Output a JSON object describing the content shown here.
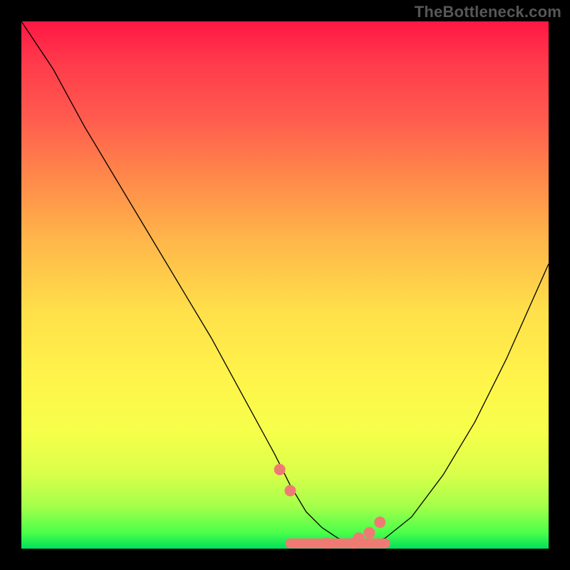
{
  "watermark": "TheBottleneck.com",
  "colors": {
    "background_frame": "#000000",
    "gradient_top": "#ff1744",
    "gradient_mid": "#ffe04a",
    "gradient_bottom": "#00e05a",
    "curve_stroke": "#000000",
    "accent_stroke": "#ef7a74"
  },
  "chart_data": {
    "type": "line",
    "title": "",
    "xlabel": "",
    "ylabel": "",
    "xlim": [
      0,
      100
    ],
    "ylim": [
      0,
      100
    ],
    "grid": false,
    "legend": false,
    "series": [
      {
        "name": "bottleneck-curve",
        "x": [
          0,
          6,
          12,
          18,
          24,
          30,
          36,
          42,
          48,
          51,
          54,
          57,
          60,
          63,
          66,
          69,
          74,
          80,
          86,
          92,
          100
        ],
        "values": [
          100,
          91,
          80,
          70,
          60,
          50,
          40,
          29,
          18,
          12,
          7,
          4,
          2,
          1,
          1,
          2,
          6,
          14,
          24,
          36,
          54
        ]
      }
    ],
    "annotations": {
      "accent_flat_region_x": [
        51,
        69
      ],
      "accent_flat_region_y": 1,
      "accent_dots_x": [
        49,
        51,
        58,
        63,
        64,
        66,
        68
      ],
      "accent_dots_y": [
        15,
        11,
        1,
        1,
        2,
        3,
        5
      ]
    },
    "background_gradient": {
      "type": "vertical",
      "stops": [
        {
          "pos": 0.0,
          "color": "#ff1744"
        },
        {
          "pos": 0.3,
          "color": "#ff8a4a"
        },
        {
          "pos": 0.55,
          "color": "#ffe04a"
        },
        {
          "pos": 0.78,
          "color": "#f6ff4a"
        },
        {
          "pos": 0.92,
          "color": "#a4ff4a"
        },
        {
          "pos": 1.0,
          "color": "#00e05a"
        }
      ]
    }
  }
}
